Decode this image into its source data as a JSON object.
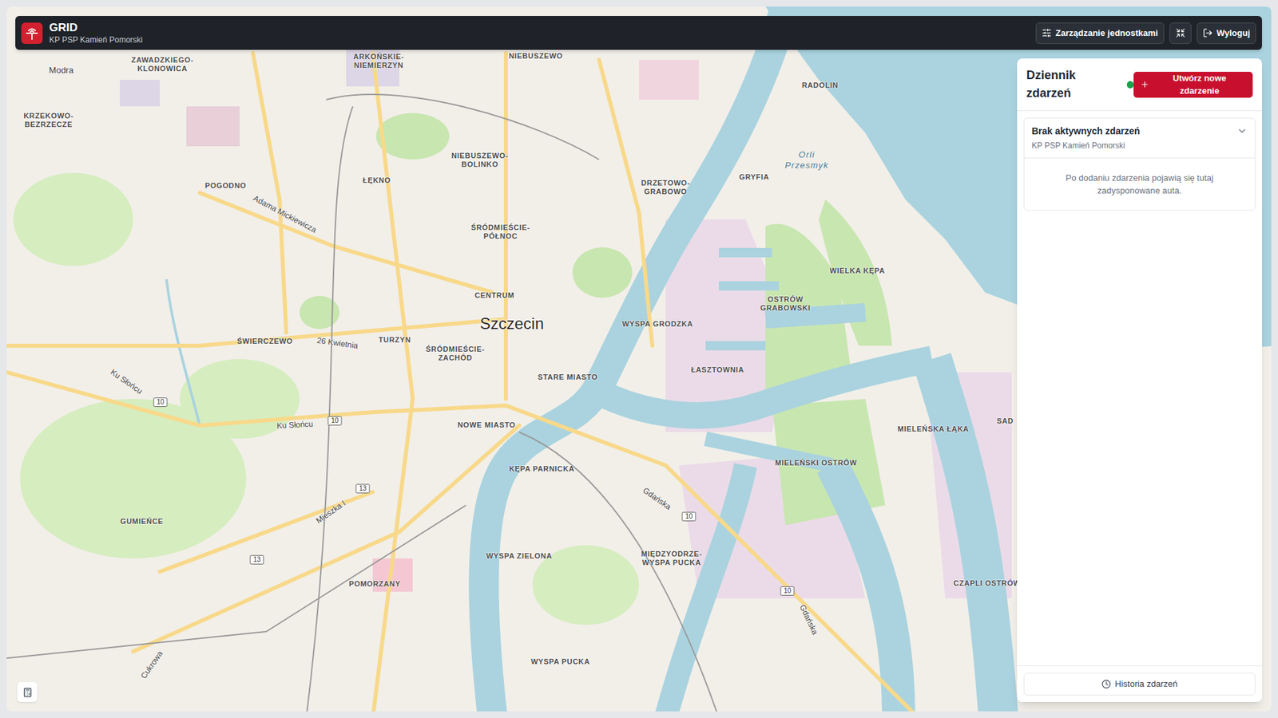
{
  "header": {
    "title": "GRID",
    "subtitle": "KP PSP Kamień Pomorski",
    "buttons": [
      {
        "label": "Zarządzanie jednostkami",
        "kind": "settings"
      },
      {
        "label": "",
        "kind": "shrink"
      },
      {
        "label": "Wyloguj",
        "kind": "logout"
      }
    ]
  },
  "panel": {
    "title": "Dziennik zdarzeń",
    "online": true,
    "create_button": "Utwórz nowe zdarzenie",
    "cards": [
      {
        "title": "Brak aktywnych zdarzeń",
        "subtitle": "KP PSP Kamień Pomorski",
        "expanded": true,
        "body": "Po dodaniu zdarzenia pojawią się tutaj zadysponowane auta."
      }
    ],
    "history_button": "Historia zdarzeń"
  },
  "map": {
    "labels": [
      {
        "text": "ARKOŃSKIE-NIEMIERZYN",
        "kind": "district"
      },
      {
        "text": "NIEBUSZEWO",
        "kind": "district"
      },
      {
        "text": "Modra",
        "kind": "place"
      },
      {
        "text": "ZAWADZKIEGO-KLONOWICA",
        "kind": "district"
      },
      {
        "text": "KRZEKOWO-BEZRZECZE",
        "kind": "district"
      },
      {
        "text": "POGODNO",
        "kind": "district"
      },
      {
        "text": "Adama Mickiewicza",
        "kind": "street"
      },
      {
        "text": "ŁĘKNO",
        "kind": "district"
      },
      {
        "text": "NIEBUSZEWO-BOLINKO",
        "kind": "district"
      },
      {
        "text": "ŚRÓDMIEŚCIE-PÓŁNOC",
        "kind": "district"
      },
      {
        "text": "DRZETOWO-GRABOWO",
        "kind": "district"
      },
      {
        "text": "GRYFIA",
        "kind": "district"
      },
      {
        "text": "RADOLIN",
        "kind": "district"
      },
      {
        "text": "Orli Przesmyk",
        "kind": "water"
      },
      {
        "text": "WIELKA KĘPA",
        "kind": "district"
      },
      {
        "text": "OSTRÓW GRABOWSKI",
        "kind": "district"
      },
      {
        "text": "WYSPA GRODZKA",
        "kind": "district"
      },
      {
        "text": "CENTRUM",
        "kind": "district"
      },
      {
        "text": "Szczecin",
        "kind": "city"
      },
      {
        "text": "ŚWIERCZEWO",
        "kind": "district"
      },
      {
        "text": "26 Kwietnia",
        "kind": "street"
      },
      {
        "text": "TURZYN",
        "kind": "district"
      },
      {
        "text": "ŚRÓDMIEŚCIE-ZACHÓD",
        "kind": "district"
      },
      {
        "text": "STARE MIASTO",
        "kind": "district"
      },
      {
        "text": "ŁASZTOWNIA",
        "kind": "district"
      },
      {
        "text": "Ku Słońcu",
        "kind": "street"
      },
      {
        "text": "Ku Słońcu",
        "kind": "street"
      },
      {
        "text": "NOWE MIASTO",
        "kind": "district"
      },
      {
        "text": "MIELEŃSKA ŁĄKA",
        "kind": "district"
      },
      {
        "text": "SAD",
        "kind": "district"
      },
      {
        "text": "MIELEŃSKI OSTRÓW",
        "kind": "district"
      },
      {
        "text": "KĘPA PARNICKA",
        "kind": "district"
      },
      {
        "text": "Gdańska",
        "kind": "street"
      },
      {
        "text": "Mieszka I",
        "kind": "street"
      },
      {
        "text": "GUMIEŃCE",
        "kind": "district"
      },
      {
        "text": "WYSPA ZIELONA",
        "kind": "district"
      },
      {
        "text": "MIĘDZYODRZE-WYSPA PUCKA",
        "kind": "district"
      },
      {
        "text": "CZAPLI OSTRÓW",
        "kind": "district"
      },
      {
        "text": "POMORZANY",
        "kind": "district"
      },
      {
        "text": "Gdańska",
        "kind": "street"
      },
      {
        "text": "WYSPA PUCKA",
        "kind": "district"
      },
      {
        "text": "Cukrowa",
        "kind": "street"
      },
      {
        "text": "10",
        "kind": "route"
      },
      {
        "text": "10",
        "kind": "route"
      },
      {
        "text": "13",
        "kind": "route"
      },
      {
        "text": "13",
        "kind": "route"
      },
      {
        "text": "10",
        "kind": "route"
      },
      {
        "text": "10",
        "kind": "route"
      }
    ]
  }
}
